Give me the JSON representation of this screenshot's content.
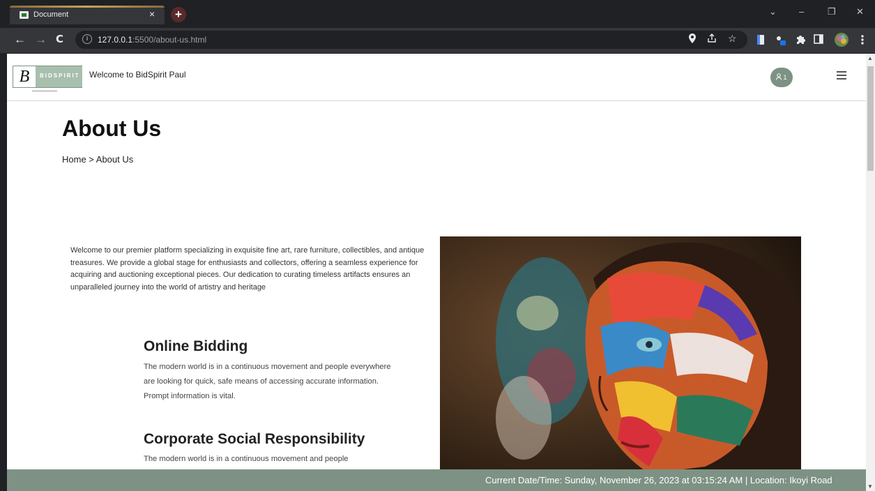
{
  "browser": {
    "tab_title": "Document",
    "tab_close": "×",
    "new_tab": "+",
    "url_host": "127.0.0.1",
    "url_path": ":5500/about-us.html",
    "window_controls": {
      "collapse": "⌄",
      "minimize": "–",
      "restore": "❐",
      "close": "✕"
    },
    "nav": {
      "back": "←",
      "forward": "→",
      "reload": "C",
      "info": "i"
    }
  },
  "header": {
    "logo_letter": "B",
    "logo_text": "BIDSPIRIT",
    "welcome": "Welcome to BidSpirit Paul",
    "user_count": "1"
  },
  "main": {
    "title": "About Us",
    "breadcrumb": "Home > About Us",
    "intro": "Welcome to our premier platform specializing in exquisite fine art, rare furniture, collectibles, and antique treasures. We provide a global stage for enthusiasts and collectors, offering a seamless experience for acquiring and auctioning exceptional pieces. Our dedication to curating timeless artifacts ensures an unparalleled journey into the world of artistry and heritage",
    "sections": [
      {
        "heading": "Online Bidding",
        "body": "The modern world is in a continuous movement and people everywhere are looking for quick, safe means of accessing accurate information. Prompt information is vital."
      },
      {
        "heading": "Corporate Social Responsibility",
        "body": "The modern world is in a continuous movement and people"
      }
    ]
  },
  "footer": {
    "status": "Current Date/Time: Sunday, November 26, 2023 at 03:15:24 AM | Location: Ikoyi Road"
  },
  "colors": {
    "brand": "#7d9284",
    "chrome_dark": "#202124",
    "chrome_toolbar": "#35363a"
  }
}
